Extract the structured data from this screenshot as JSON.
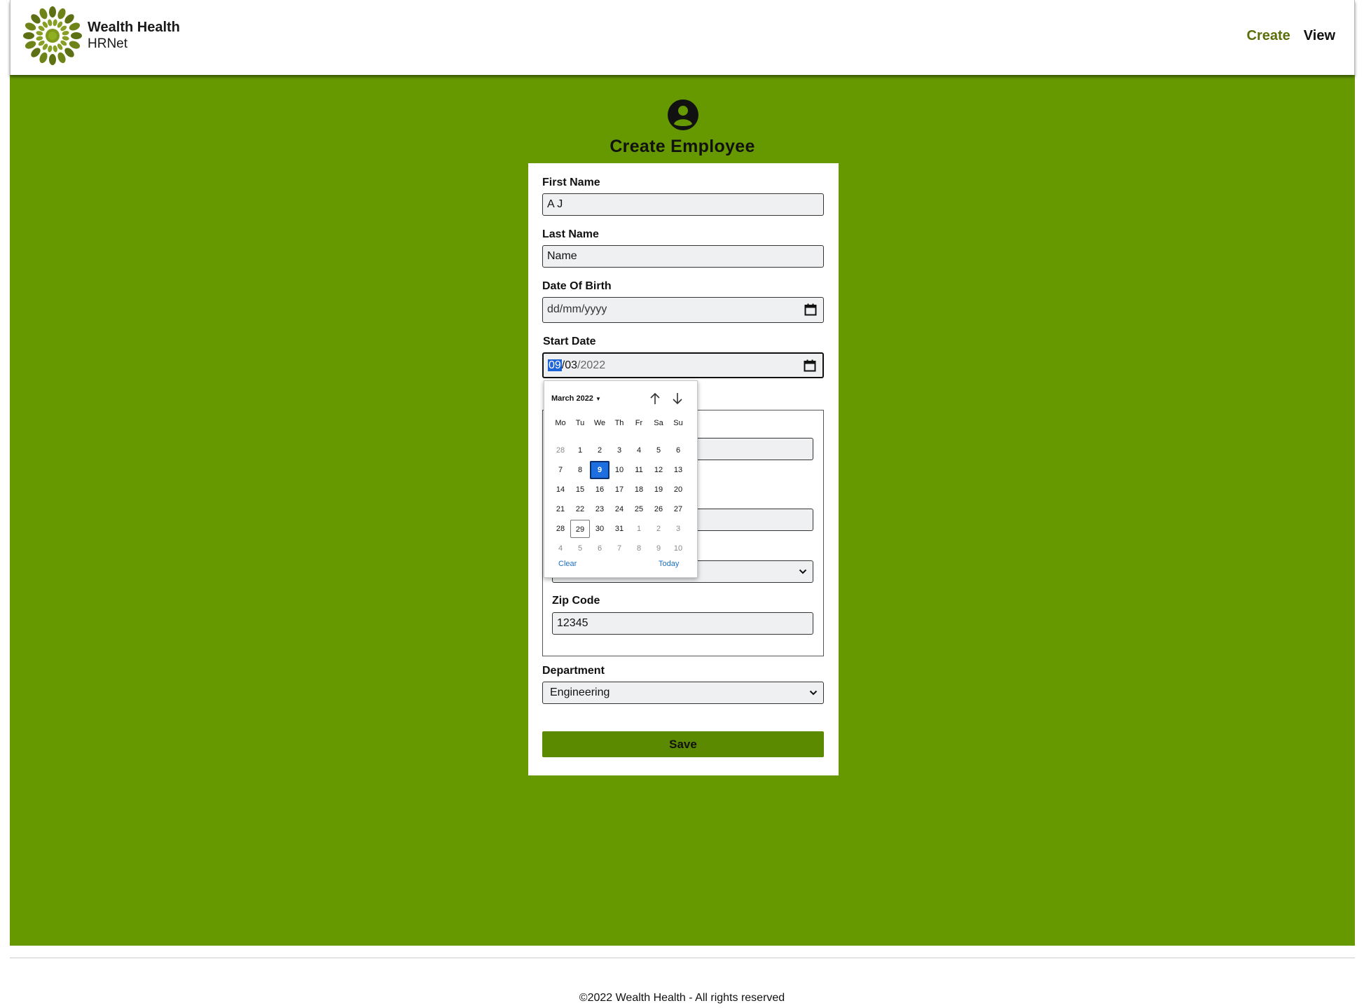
{
  "header": {
    "brand_title": "Wealth Health",
    "brand_subtitle": "HRNet",
    "nav": {
      "create": "Create",
      "view": "View"
    }
  },
  "colors": {
    "main_bg": "#669900",
    "nav_active": "#5a6f0a",
    "save_button": "#5b8a00",
    "selected_day": "#1d6fe0"
  },
  "icons": {
    "logo": "sunburst-logo-icon",
    "avatar": "user-circle-icon",
    "calendar": "calendar-icon"
  },
  "page": {
    "title": "Create Employee"
  },
  "form": {
    "first_name": {
      "label": "First Name",
      "value": "A J"
    },
    "last_name": {
      "label": "Last Name",
      "value": "Name"
    },
    "date_of_birth": {
      "label": "Date Of Birth",
      "placeholder": "dd/mm/yyyy"
    },
    "start_date": {
      "label": "Start Date",
      "day": "09",
      "sep1": "/",
      "month": "03",
      "sep2": "/",
      "year": "2022"
    },
    "zip_code": {
      "label": "Zip Code",
      "value": "12345"
    },
    "department": {
      "label": "Department",
      "value": "Engineering"
    },
    "save_label": "Save"
  },
  "datepicker": {
    "month_label": "March 2022",
    "weekdays": [
      "Mo",
      "Tu",
      "We",
      "Th",
      "Fr",
      "Sa",
      "Su"
    ],
    "weeks": [
      [
        "28",
        "1",
        "2",
        "3",
        "4",
        "5",
        "6"
      ],
      [
        "7",
        "8",
        "9",
        "10",
        "11",
        "12",
        "13"
      ],
      [
        "14",
        "15",
        "16",
        "17",
        "18",
        "19",
        "20"
      ],
      [
        "21",
        "22",
        "23",
        "24",
        "25",
        "26",
        "27"
      ],
      [
        "28",
        "29",
        "30",
        "31",
        "1",
        "2",
        "3"
      ],
      [
        "4",
        "5",
        "6",
        "7",
        "8",
        "9",
        "10"
      ]
    ],
    "selected_day": "9",
    "today_day": "29",
    "clear_label": "Clear",
    "today_label": "Today"
  },
  "footer": {
    "text": "©2022 Wealth Health - All rights reserved"
  }
}
